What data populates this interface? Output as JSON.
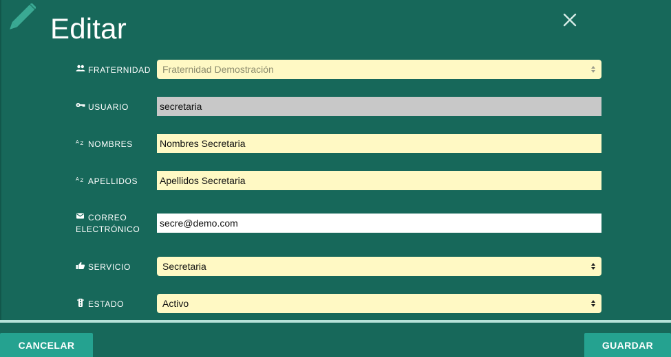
{
  "dialog": {
    "title": "Editar",
    "header_icon": "pencil-icon",
    "close_icon": "close-icon"
  },
  "fields": {
    "fraternidad": {
      "label": "FRATERNIDAD",
      "icon": "people-icon",
      "value": "Fraternidad Demostración",
      "disabled": true
    },
    "usuario": {
      "label": "USUARIO",
      "icon": "key-icon",
      "value": "secretaria",
      "readonly": true
    },
    "nombres": {
      "label": "NOMBRES",
      "icon": "sort-az-icon",
      "value": "Nombres Secretaria"
    },
    "apellidos": {
      "label": "APELLIDOS",
      "icon": "sort-az-icon",
      "value": "Apellidos Secretaria"
    },
    "correo": {
      "label_line1": "CORREO",
      "label_line2": "ELECTRÓNICO",
      "icon": "envelope-icon",
      "value": "secre@demo.com"
    },
    "servicio": {
      "label": "SERVICIO",
      "icon": "thumbs-up-icon",
      "value": "Secretaria"
    },
    "estado": {
      "label": "ESTADO",
      "icon": "traffic-light-icon",
      "value": "Activo"
    }
  },
  "footer": {
    "cancel_label": "CANCELAR",
    "save_label": "GUARDAR"
  },
  "colors": {
    "background": "#17685a",
    "field_yellow": "#fff9c4",
    "field_readonly": "#c8c8c8",
    "button": "#25a290",
    "divider": "#b7e2d9"
  }
}
